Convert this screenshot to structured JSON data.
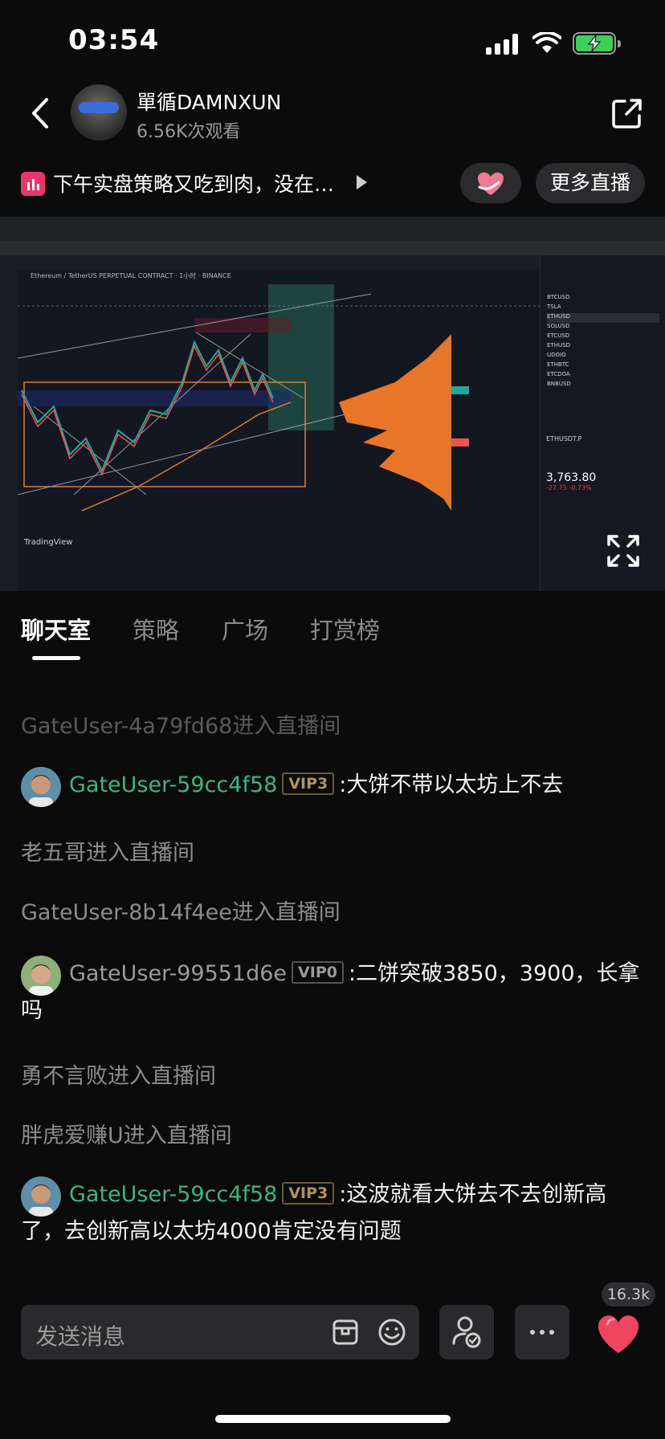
{
  "status_bar": {
    "time": "03:54"
  },
  "header": {
    "host_name": "單循DAMNXUN",
    "views": "6.56K次观看"
  },
  "stream": {
    "title": "下午实盘策略又吃到肉，没在…",
    "more_live_label": "更多直播"
  },
  "video": {
    "symbol": "Ethereum / TetherUS PERPETUAL CONTRACT · 1小时 · BINANCE",
    "logo": "TradingView",
    "side_pair": "ETHUSDT.P",
    "side_price": "3,763.80",
    "side_change": "-27.75 -0.73%",
    "watchlist": [
      "BTCUSD",
      "TSLA",
      "ETHUSD",
      "SOLUSD",
      "ETCUSD",
      "ETHUSD",
      "UDOIO",
      "ETHBTC",
      "ETCDOA",
      "BNBUSD"
    ]
  },
  "tabs": [
    {
      "label": "聊天室",
      "active": true
    },
    {
      "label": "策略",
      "active": false
    },
    {
      "label": "广场",
      "active": false
    },
    {
      "label": "打赏榜",
      "active": false
    }
  ],
  "chat": [
    {
      "type": "system",
      "text": "GateUser-4a79fd68进入直播间"
    },
    {
      "type": "message",
      "user": "GateUser-59cc4f58",
      "vip": "VIP3",
      "text": ":大饼不带以太坊上不去"
    },
    {
      "type": "system",
      "text": "老五哥进入直播间"
    },
    {
      "type": "system",
      "text": "GateUser-8b14f4ee进入直播间"
    },
    {
      "type": "message",
      "user": "GateUser-99551d6e",
      "vip": "VIP0",
      "text": ":二饼突破3850，3900，长拿吗"
    },
    {
      "type": "system",
      "text": "勇不言败进入直播间"
    },
    {
      "type": "system",
      "text": "胖虎爱赚U进入直播间"
    },
    {
      "type": "message",
      "user": "GateUser-59cc4f58",
      "vip": "VIP3",
      "text": ":这波就看大饼去不去创新高了，去创新高以太坊4000肯定没有问题"
    }
  ],
  "input": {
    "placeholder": "发送消息",
    "like_count": "16.3k"
  },
  "colors": {
    "background": "#0b0b0c",
    "username_green": "#3db380",
    "vip_gold": "#b0935a",
    "live_pink": "#e8376c",
    "heart_red": "#f0455f"
  }
}
